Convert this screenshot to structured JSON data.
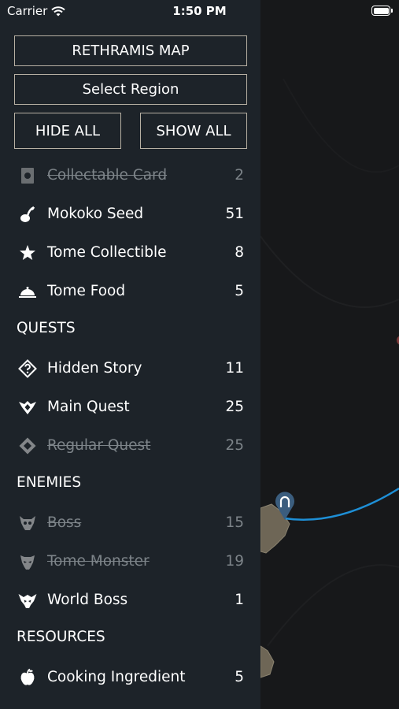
{
  "status_bar": {
    "carrier": "Carrier",
    "time": "1:50 PM"
  },
  "map": {
    "route_color": "#1e8fd6",
    "marker_color": "#3b5d7e"
  },
  "drawer": {
    "map_button": "RETHRAMIS MAP",
    "region_button": "Select Region",
    "hide_all": "HIDE ALL",
    "show_all": "SHOW ALL",
    "items_top": [
      {
        "label": "Collectable Card",
        "count": "2",
        "icon": "card-icon",
        "enabled": false
      },
      {
        "label": "Mokoko Seed",
        "count": "51",
        "icon": "seed-icon",
        "enabled": true
      },
      {
        "label": "Tome Collectible",
        "count": "8",
        "icon": "star-icon",
        "enabled": true
      },
      {
        "label": "Tome Food",
        "count": "5",
        "icon": "food-dome-icon",
        "enabled": true
      }
    ],
    "quests_header": "QUESTS",
    "quests": [
      {
        "label": "Hidden Story",
        "count": "11",
        "icon": "question-diamond-icon",
        "enabled": true
      },
      {
        "label": "Main Quest",
        "count": "25",
        "icon": "main-quest-icon",
        "enabled": true
      },
      {
        "label": "Regular Quest",
        "count": "25",
        "icon": "regular-quest-icon",
        "enabled": false
      }
    ],
    "enemies_header": "ENEMIES",
    "enemies": [
      {
        "label": "Boss",
        "count": "15",
        "icon": "boss-skull-icon",
        "enabled": false
      },
      {
        "label": "Tome Monster",
        "count": "19",
        "icon": "monster-skull-icon",
        "enabled": false
      },
      {
        "label": "World Boss",
        "count": "1",
        "icon": "world-boss-icon",
        "enabled": true
      }
    ],
    "resources_header": "RESOURCES",
    "resources": [
      {
        "label": "Cooking Ingredient",
        "count": "5",
        "icon": "apple-icon",
        "enabled": true
      }
    ]
  }
}
